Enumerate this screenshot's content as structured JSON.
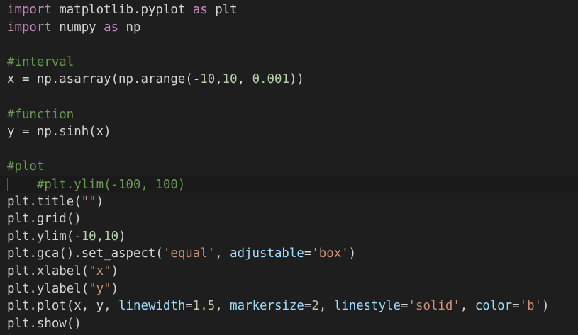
{
  "code": {
    "lines": [
      [
        {
          "c": "kw",
          "t": "import"
        },
        {
          "c": "pl",
          "t": " matplotlib.pyplot "
        },
        {
          "c": "kw",
          "t": "as"
        },
        {
          "c": "pl",
          "t": " plt"
        }
      ],
      [
        {
          "c": "kw",
          "t": "import"
        },
        {
          "c": "pl",
          "t": " numpy "
        },
        {
          "c": "kw",
          "t": "as"
        },
        {
          "c": "pl",
          "t": " np"
        }
      ],
      [],
      [
        {
          "c": "cm",
          "t": "#interval"
        }
      ],
      [
        {
          "c": "pl",
          "t": "x = np.asarray(np.arange(-"
        },
        {
          "c": "num",
          "t": "10"
        },
        {
          "c": "pl",
          "t": ","
        },
        {
          "c": "num",
          "t": "10"
        },
        {
          "c": "pl",
          "t": ", "
        },
        {
          "c": "num",
          "t": "0.001"
        },
        {
          "c": "pl",
          "t": "))"
        }
      ],
      [],
      [
        {
          "c": "cm",
          "t": "#function"
        }
      ],
      [
        {
          "c": "pl",
          "t": "y = np.sinh(x)"
        }
      ],
      [],
      [
        {
          "c": "cm",
          "t": "#plot"
        }
      ],
      [
        {
          "c": "pl",
          "t": "    "
        },
        {
          "c": "cm",
          "t": "#plt.ylim(-100, 100)"
        }
      ],
      [
        {
          "c": "pl",
          "t": "plt.title("
        },
        {
          "c": "str",
          "t": "\"\""
        },
        {
          "c": "pl",
          "t": ")"
        }
      ],
      [
        {
          "c": "pl",
          "t": "plt.grid()"
        }
      ],
      [
        {
          "c": "pl",
          "t": "plt.ylim(-"
        },
        {
          "c": "num",
          "t": "10"
        },
        {
          "c": "pl",
          "t": ","
        },
        {
          "c": "num",
          "t": "10"
        },
        {
          "c": "pl",
          "t": ")"
        }
      ],
      [
        {
          "c": "pl",
          "t": "plt.gca().set_aspect("
        },
        {
          "c": "str",
          "t": "'equal'"
        },
        {
          "c": "pl",
          "t": ", "
        },
        {
          "c": "prm",
          "t": "adjustable"
        },
        {
          "c": "pl",
          "t": "="
        },
        {
          "c": "str",
          "t": "'box'"
        },
        {
          "c": "pl",
          "t": ")"
        }
      ],
      [
        {
          "c": "pl",
          "t": "plt.xlabel("
        },
        {
          "c": "str",
          "t": "\"x\""
        },
        {
          "c": "pl",
          "t": ")"
        }
      ],
      [
        {
          "c": "pl",
          "t": "plt.ylabel("
        },
        {
          "c": "str",
          "t": "\"y\""
        },
        {
          "c": "pl",
          "t": ")"
        }
      ],
      [
        {
          "c": "pl",
          "t": "plt.plot(x, y, "
        },
        {
          "c": "prm",
          "t": "linewidth"
        },
        {
          "c": "pl",
          "t": "="
        },
        {
          "c": "num",
          "t": "1.5"
        },
        {
          "c": "pl",
          "t": ", "
        },
        {
          "c": "prm",
          "t": "markersize"
        },
        {
          "c": "pl",
          "t": "="
        },
        {
          "c": "num",
          "t": "2"
        },
        {
          "c": "pl",
          "t": ", "
        },
        {
          "c": "prm",
          "t": "linestyle"
        },
        {
          "c": "pl",
          "t": "="
        },
        {
          "c": "str",
          "t": "'solid'"
        },
        {
          "c": "pl",
          "t": ", "
        },
        {
          "c": "prm",
          "t": "color"
        },
        {
          "c": "pl",
          "t": "="
        },
        {
          "c": "str",
          "t": "'b'"
        },
        {
          "c": "pl",
          "t": ")"
        }
      ],
      [
        {
          "c": "pl",
          "t": "plt.show()"
        }
      ]
    ],
    "current_line_index": 10
  },
  "theme": {
    "background": "#1e1e1e",
    "keyword": "#c586c0",
    "comment": "#6a9955",
    "number": "#b5cea8",
    "string": "#ce9178",
    "parameter": "#9cdcfe",
    "plain": "#d4d4d4"
  }
}
